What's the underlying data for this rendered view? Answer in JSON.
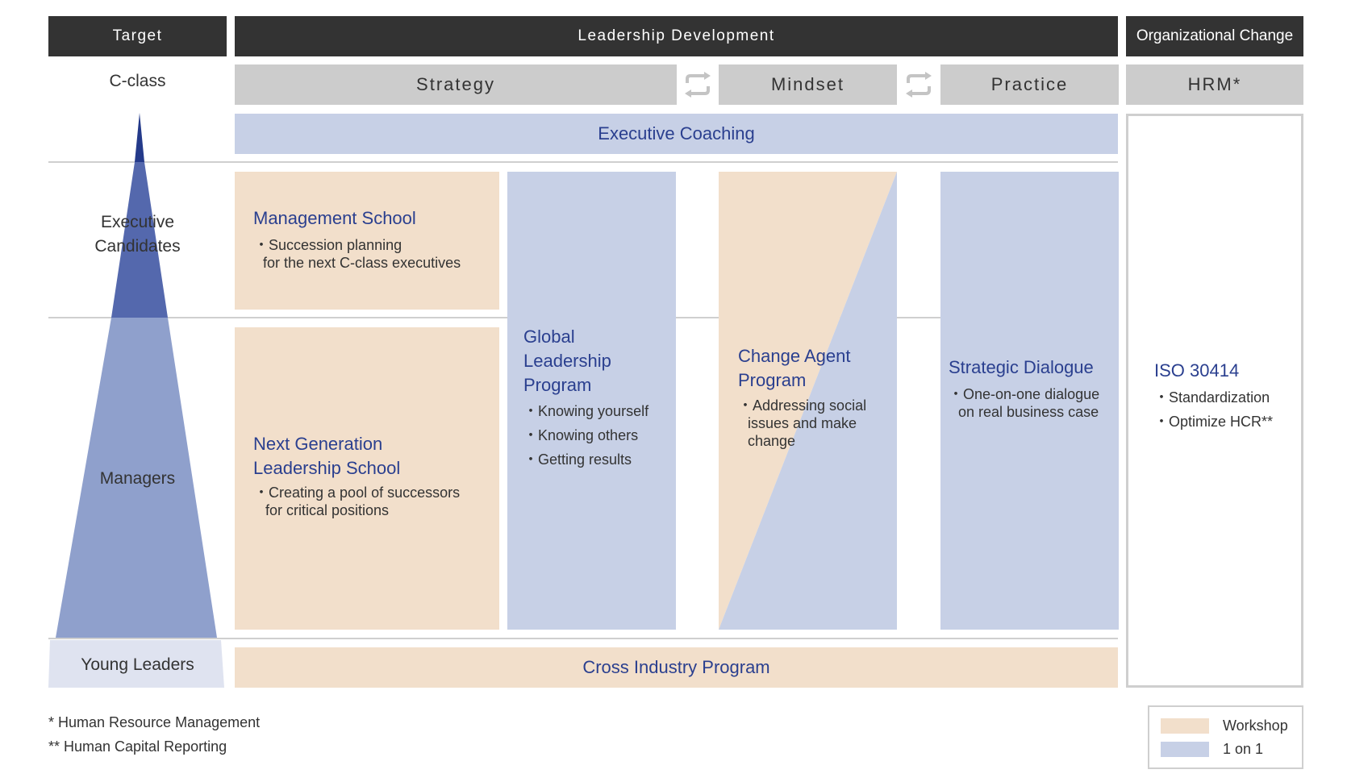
{
  "headers": {
    "target": "Target",
    "leadership": "Leadership Development",
    "org_change": "Organizational Change"
  },
  "subheaders": {
    "strategy": "Strategy",
    "mindset": "Mindset",
    "practice": "Practice",
    "hrm": "HRM*"
  },
  "tiers": {
    "c_class": "C-class",
    "exec_line1": "Executive",
    "exec_line2": "Candidates",
    "managers": "Managers",
    "young": "Young Leaders"
  },
  "executive_coaching": "Executive Coaching",
  "cross_industry": "Cross Industry Program",
  "management_school": {
    "title": "Management School",
    "b1": "・Succession planning",
    "b2": "for the next C-class executives"
  },
  "next_gen": {
    "title1": "Next Generation",
    "title2": "Leadership School",
    "b1": "・Creating a pool of successors",
    "b2": "for critical positions"
  },
  "global": {
    "title1": "Global",
    "title2": "Leadership",
    "title3": "Program",
    "b1": "・Knowing yourself",
    "b2": "・Knowing others",
    "b3": "・Getting results"
  },
  "change_agent": {
    "title1": "Change Agent",
    "title2": "Program",
    "b1": "・Addressing social",
    "b2": "issues and make",
    "b3": "change"
  },
  "strategic": {
    "title": "Strategic Dialogue",
    "b1": "・One-on-one dialogue",
    "b2": "on real business case"
  },
  "iso": {
    "title": "ISO 30414",
    "b1": "・Standardization",
    "b2": "・Optimize HCR**"
  },
  "footnotes": {
    "f1": "* Human Resource Management",
    "f2": "** Human Capital Reporting"
  },
  "legend": {
    "workshop": "Workshop",
    "one_on_one": "1 on 1"
  },
  "colors": {
    "peach": "#f2dfcb",
    "blue_light": "#c7d0e6",
    "navy": "#2a3f8f",
    "header_dark": "#333333",
    "header_gray": "#cccccc"
  }
}
